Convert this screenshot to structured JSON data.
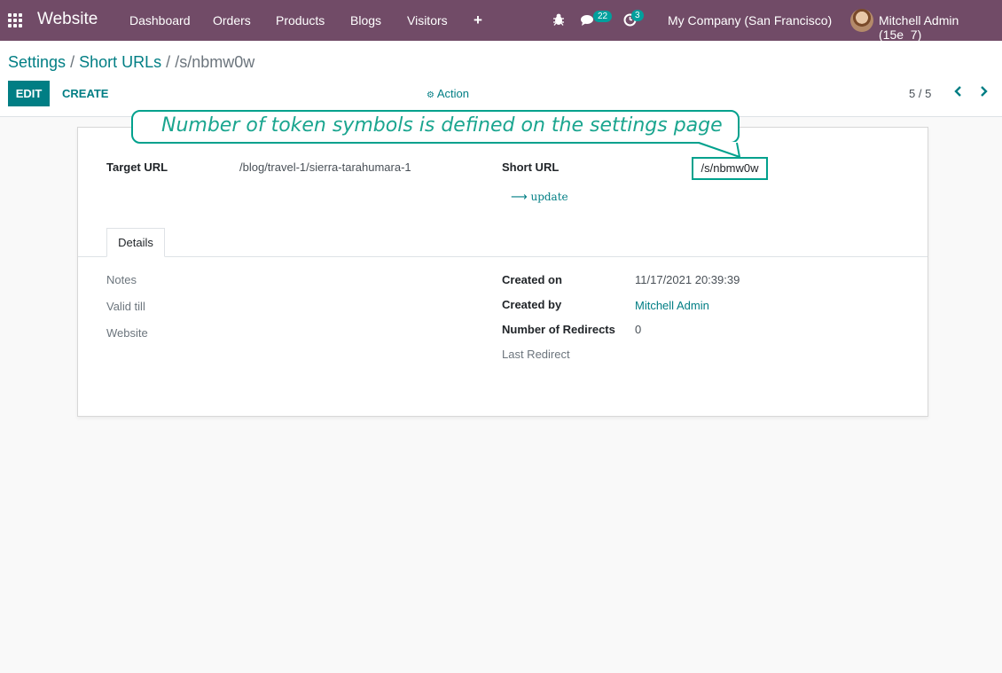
{
  "navbar": {
    "brand": "Website",
    "menu": [
      "Dashboard",
      "Orders",
      "Products",
      "Blogs",
      "Visitors"
    ],
    "plus": "+",
    "messages_count": "22",
    "activities_count": "3",
    "company": "My Company (San Francisco)",
    "user": "Mitchell Admin (15e_7)",
    "color": "#714b67"
  },
  "breadcrumb": {
    "settings": "Settings",
    "sep1": "/",
    "short_urls": "Short URLs",
    "sep2": "/",
    "current": "/s/nbmw0w"
  },
  "toolbar": {
    "edit": "EDIT",
    "create": "CREATE",
    "action": "Action",
    "pager": "5 / 5"
  },
  "form": {
    "target_url_label": "Target URL",
    "target_url_value": "/blog/travel-1/sierra-tarahumara-1",
    "short_url_label": "Short URL",
    "short_url_value": "/s/nbmw0w",
    "update_link": "update",
    "tab_details": "Details",
    "notes_label": "Notes",
    "valid_till_label": "Valid till",
    "website_label": "Website",
    "created_on_label": "Created on",
    "created_on_value": "11/17/2021 20:39:39",
    "created_by_label": "Created by",
    "created_by_value": "Mitchell Admin",
    "redirects_label": "Number of Redirects",
    "redirects_value": "0",
    "last_redirect_label": "Last Redirect"
  },
  "annotation": {
    "text": "Number of token symbols is defined on the settings page",
    "color": "#00a18d"
  },
  "colors": {
    "primary": "#017e84",
    "highlight": "#00a18d"
  }
}
